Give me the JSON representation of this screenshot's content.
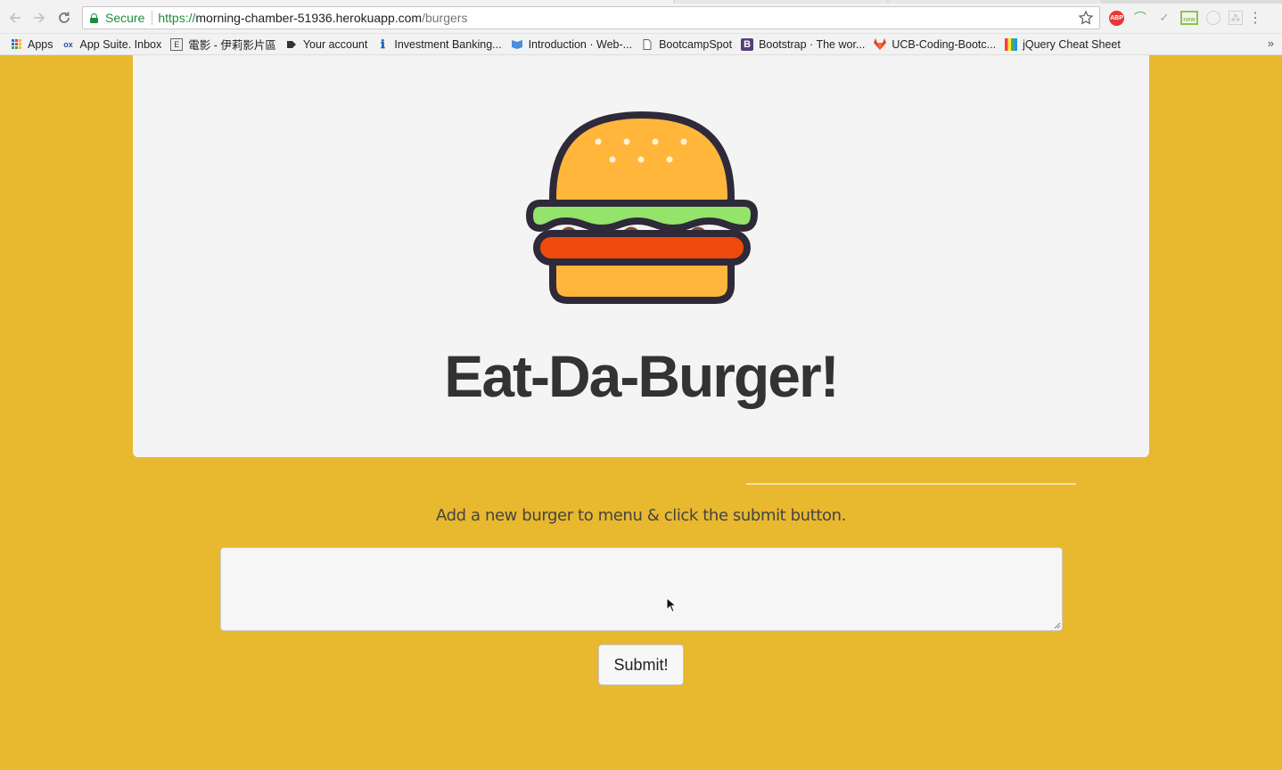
{
  "browser": {
    "secure_label": "Secure",
    "url_scheme": "https://",
    "url_host": "morning-chamber-51936.herokuapp.com",
    "url_path": "/burgers",
    "bookmarks": [
      {
        "label": "Apps",
        "icon": "apps-grid-icon"
      },
      {
        "label": "App Suite. Inbox",
        "icon": "ox-icon"
      },
      {
        "label": "電影 - 伊莉影片區",
        "icon": "eyny-icon"
      },
      {
        "label": "Your account",
        "icon": "tag-icon"
      },
      {
        "label": "Investment Banking...",
        "icon": "info-icon"
      },
      {
        "label": "Introduction · Web-...",
        "icon": "book-icon"
      },
      {
        "label": "BootcampSpot",
        "icon": "page-icon"
      },
      {
        "label": "Bootstrap · The wor...",
        "icon": "bootstrap-icon"
      },
      {
        "label": "UCB-Coding-Bootc...",
        "icon": "gitlab-icon"
      },
      {
        "label": "jQuery Cheat Sheet",
        "icon": "jquery-icon"
      }
    ],
    "extensions": {
      "abp": "ABP",
      "new_badge": "new"
    }
  },
  "page": {
    "title": "Eat-Da-Burger!",
    "instructions": "Add a new burger to menu & click the submit button.",
    "input_value": "",
    "submit_label": "Submit!"
  },
  "colors": {
    "page_background": "#e8b82e",
    "jumbotron_background": "#f4f4f4",
    "bun": "#ffb63b",
    "lettuce": "#94e36b",
    "patty": "#ef4a0d",
    "outline": "#2f2a3a"
  }
}
